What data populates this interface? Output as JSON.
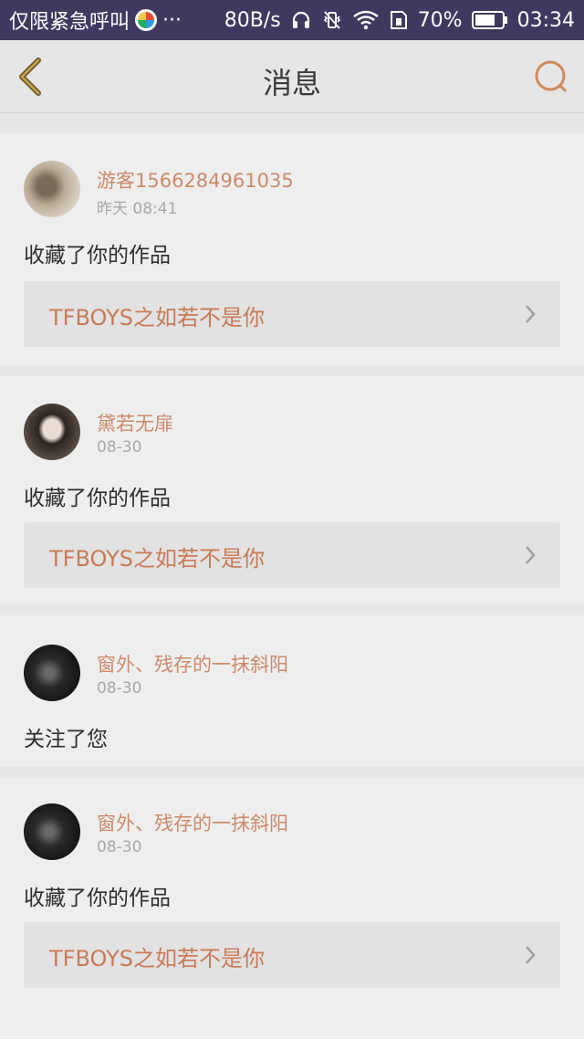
{
  "status_bar": {
    "carrier": "仅限紧急呼叫",
    "more": "···",
    "speed": "80B/s",
    "battery": "70%",
    "time": "03:34"
  },
  "header": {
    "title": "消息",
    "back_icon": "back-chevron-icon",
    "search_icon": "search-icon"
  },
  "colors": {
    "accent": "#cc8a6a",
    "link_text": "#c97a55",
    "status_bar": "#3f3960"
  },
  "messages": [
    {
      "username": "游客1566284961035",
      "time": "昨天 08:41",
      "action": "收藏了你的作品",
      "work_title": "TFBOYS之如若不是你"
    },
    {
      "username": "黛若无扉",
      "time": "08-30",
      "action": "收藏了你的作品",
      "work_title": "TFBOYS之如若不是你"
    },
    {
      "username": "窗外、残存的一抹斜阳",
      "time": "08-30",
      "action": "关注了您"
    },
    {
      "username": "窗外、残存的一抹斜阳",
      "time": "08-30",
      "action": "收藏了你的作品",
      "work_title": "TFBOYS之如若不是你"
    }
  ]
}
